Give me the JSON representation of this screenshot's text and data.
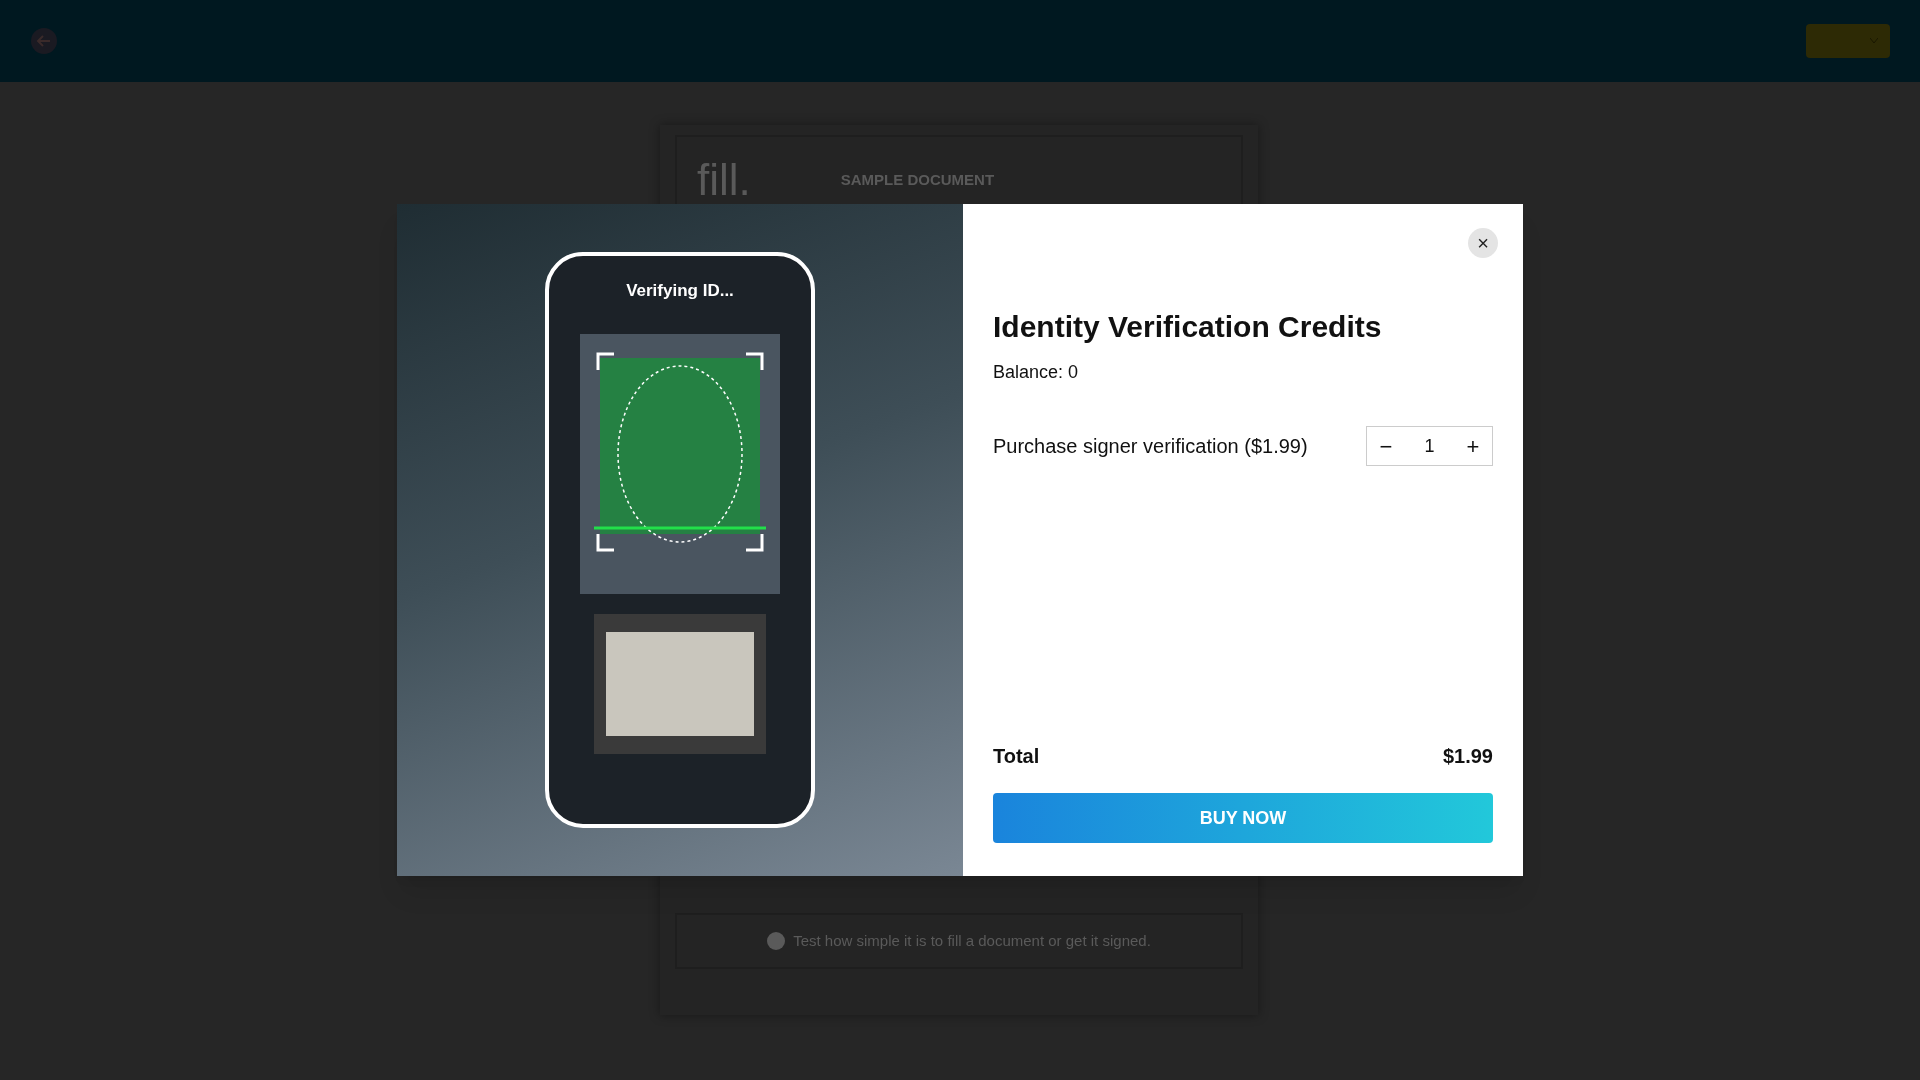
{
  "background_document": {
    "logo": "fill.",
    "title": "SAMPLE DOCUMENT",
    "footer_note": "Test how simple it is to fill a document or get it signed."
  },
  "modal": {
    "illustration": {
      "status": "Verifying ID..."
    },
    "close": "×",
    "title": "Identity Verification Credits",
    "balance": "Balance: 0",
    "purchase_label": "Purchase signer verification ($1.99)",
    "quantity": {
      "decrement": "−",
      "value": "1",
      "increment": "+"
    },
    "total_label": "Total",
    "total_value": "$1.99",
    "buy_button": "BUY NOW"
  }
}
